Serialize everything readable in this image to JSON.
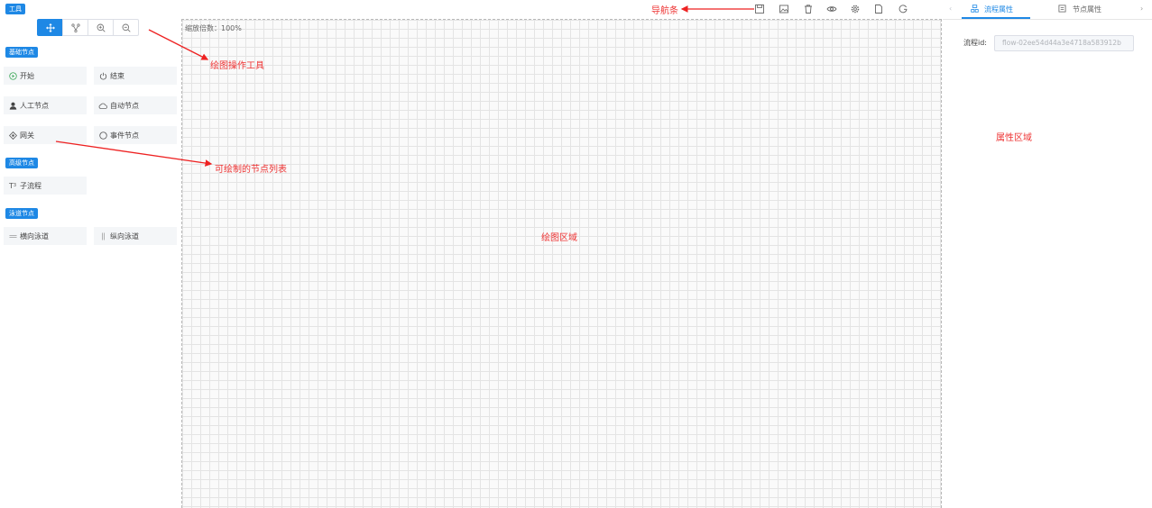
{
  "palette": {
    "tools_label": "工具",
    "basic_label": "基础节点",
    "advanced_label": "高级节点",
    "lane_label": "泳道节点",
    "tools": [
      {
        "name": "move-tool",
        "icon": "move-icon",
        "active": true
      },
      {
        "name": "connect-tool",
        "icon": "branch-icon",
        "active": false
      },
      {
        "name": "zoom-in-tool",
        "icon": "zoom-in-icon",
        "active": false
      },
      {
        "name": "zoom-out-tool",
        "icon": "zoom-out-icon",
        "active": false
      }
    ],
    "nodes": {
      "start": "开始",
      "end": "结束",
      "manual": "人工节点",
      "auto": "自动节点",
      "gateway": "网关",
      "event": "事件节点",
      "subflow": "子流程",
      "h_lane": "横向泳道",
      "v_lane": "纵向泳道"
    }
  },
  "canvas": {
    "zoom_text": "缩放倍数：100%"
  },
  "toolbar": {
    "icons": [
      "save-icon",
      "image-icon",
      "delete-icon",
      "preview-icon",
      "settings-icon",
      "document-icon",
      "refresh-icon"
    ]
  },
  "right_panel": {
    "tab_flow": "流程属性",
    "tab_node": "节点属性",
    "flow_id_label": "流程id:",
    "flow_id_value": "flow-02ee54d44a3e4718a583912b"
  },
  "annotations": {
    "navbar": "导航条",
    "draw_tools": "绘图操作工具",
    "node_list": "可绘制的节点列表",
    "draw_area": "绘图区域",
    "prop_area": "属性区域"
  },
  "colors": {
    "accent": "#1e88e5",
    "annotation": "#ee3333"
  }
}
